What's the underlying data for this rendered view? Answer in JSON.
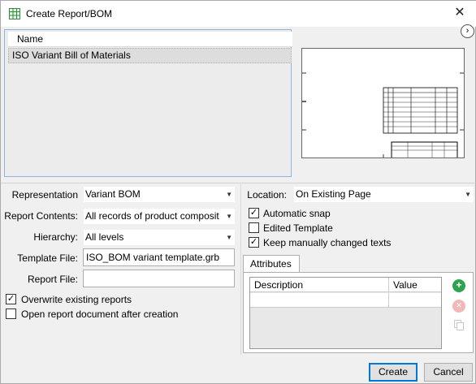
{
  "window": {
    "title": "Create Report/BOM",
    "close_glyph": "✕",
    "app_icon": "spreadsheet-icon"
  },
  "list": {
    "header": "Name",
    "items": [
      "ISO Variant Bill of Materials"
    ]
  },
  "preview_nav_glyph": "›",
  "form": {
    "representation_label": "Representation",
    "representation_value": "Variant BOM",
    "report_contents_label": "Report Contents:",
    "report_contents_value": "All records of product composit",
    "hierarchy_label": "Hierarchy:",
    "hierarchy_value": "All levels",
    "template_file_label": "Template File:",
    "template_file_value": "ISO_BOM variant template.grb",
    "report_file_label": "Report File:",
    "report_file_value": "",
    "overwrite_label": "Overwrite existing reports",
    "overwrite_checked": true,
    "open_doc_label": "Open report document after creation",
    "open_doc_checked": false
  },
  "right_form": {
    "location_label": "Location:",
    "location_value": "On Existing Page",
    "auto_snap_label": "Automatic snap",
    "auto_snap_checked": true,
    "edited_template_label": "Edited Template",
    "edited_template_checked": false,
    "keep_texts_label": "Keep manually changed texts",
    "keep_texts_checked": true
  },
  "attributes": {
    "tab_label": "Attributes",
    "columns": [
      "Description",
      "Value"
    ]
  },
  "check_glyph": "✓",
  "dropdown_glyph": "▼",
  "add_glyph": "+",
  "remove_glyph": "✕",
  "buttons": {
    "create": "Create",
    "cancel": "Cancel"
  },
  "colors": {
    "accent": "#0078d7",
    "add_green": "#2ea44f",
    "remove_disabled": "#f2b8b8"
  }
}
